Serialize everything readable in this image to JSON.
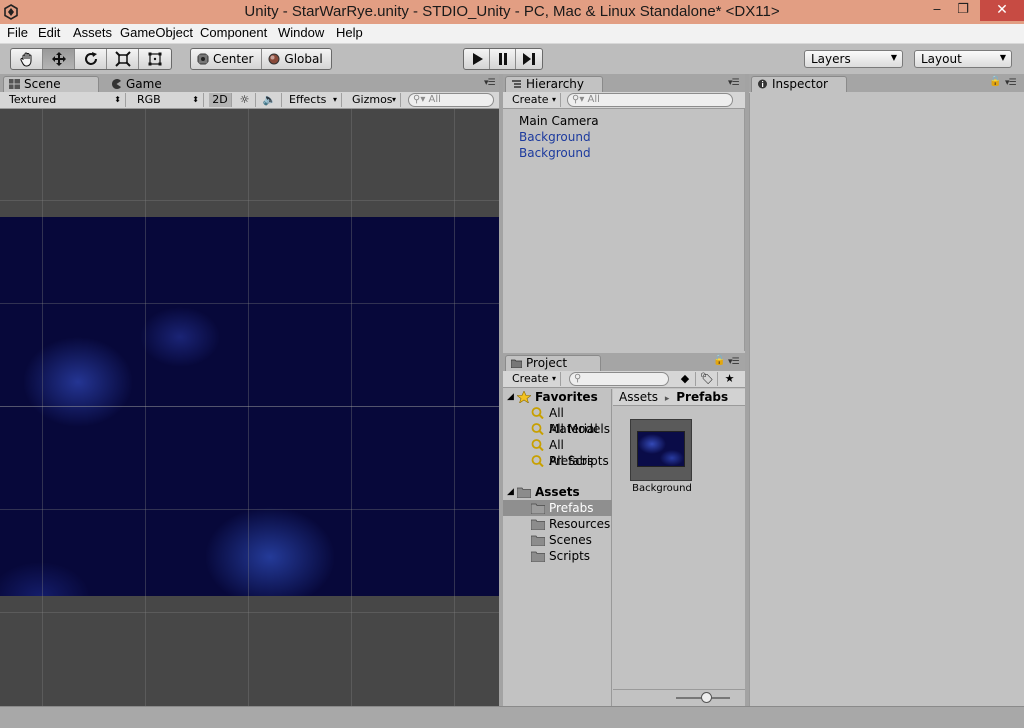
{
  "window": {
    "title": "Unity - StarWarRye.unity - STDIO_Unity - PC, Mac & Linux Standalone* <DX11>",
    "minimize": "‒",
    "maximize": "❐",
    "close": "✕"
  },
  "menu": [
    "File",
    "Edit",
    "Assets",
    "GameObject",
    "Component",
    "Window",
    "Help"
  ],
  "toolbar": {
    "pivot_center": "Center",
    "pivot_global": "Global",
    "layers": "Layers",
    "layout": "Layout"
  },
  "scene_panel": {
    "tab_scene": "Scene",
    "tab_game": "Game",
    "shading_mode": "Textured",
    "render_mode": "RGB",
    "mode_2d": "2D",
    "effects": "Effects",
    "gizmos": "Gizmos",
    "search_placeholder": "All"
  },
  "hierarchy": {
    "tab": "Hierarchy",
    "create": "Create",
    "search_placeholder": "All",
    "items": [
      {
        "label": "Main Camera",
        "color": "#000000"
      },
      {
        "label": "Background",
        "color": "#1c3a9e"
      },
      {
        "label": "Background",
        "color": "#1c3a9e"
      }
    ]
  },
  "project": {
    "tab": "Project",
    "create": "Create",
    "favorites_label": "Favorites",
    "favorites": [
      "All Material",
      "All Models",
      "All Prefabs",
      "All Scripts"
    ],
    "assets_label": "Assets",
    "folders": [
      "Prefabs",
      "Resources",
      "Scenes",
      "Scripts"
    ],
    "selected_folder": "Prefabs",
    "breadcrumb_root": "Assets",
    "breadcrumb_sep": "▸",
    "breadcrumb_current": "Prefabs",
    "assets": [
      {
        "label": "Background"
      }
    ]
  },
  "inspector": {
    "tab": "Inspector"
  },
  "colors": {
    "titlebar": "#e29e83",
    "close_button": "#c74b43",
    "selection": "#8f8f8f",
    "scene_space": "#07083a",
    "hierarchy_prefab_text": "#1c3a9e"
  }
}
